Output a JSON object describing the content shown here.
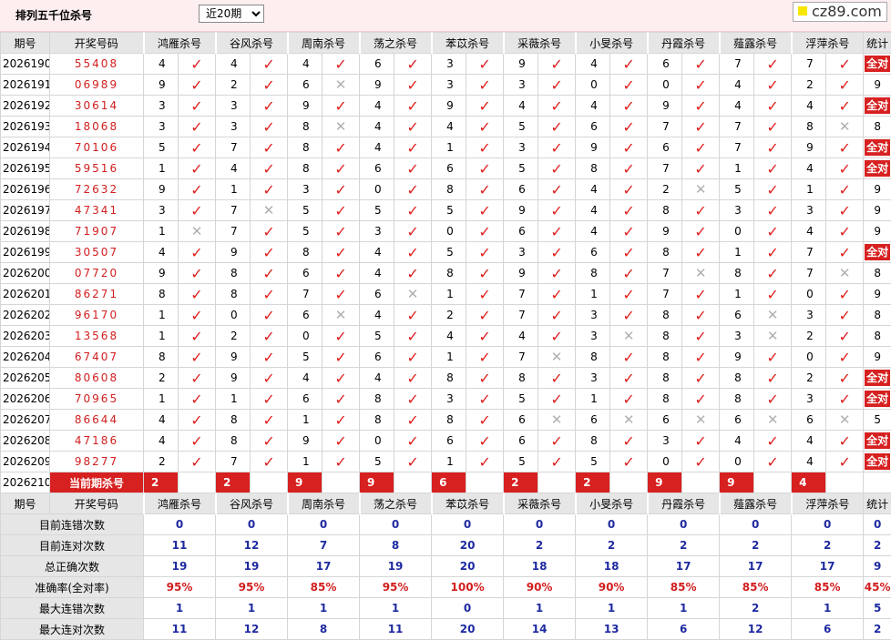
{
  "page": {
    "title": "排列五千位杀号",
    "period_select": {
      "value": "近20期",
      "options": [
        "近20期"
      ]
    },
    "logo": "cz89.com"
  },
  "headers": {
    "period": "期号",
    "draw": "开奖号码",
    "experts": [
      "鸿雁杀号",
      "谷风杀号",
      "周南杀号",
      "荡之杀号",
      "苯苡杀号",
      "采薇杀号",
      "小旻杀号",
      "丹霞杀号",
      "薤露杀号",
      "浮萍杀号"
    ],
    "total": "统计"
  },
  "rows": [
    {
      "period": "2026190",
      "draw": "55408",
      "kills": [
        4,
        4,
        4,
        6,
        3,
        9,
        4,
        6,
        7,
        7
      ],
      "ok": [
        1,
        1,
        1,
        1,
        1,
        1,
        1,
        1,
        1,
        1
      ],
      "count": "全对",
      "all": true
    },
    {
      "period": "2026191",
      "draw": "06989",
      "kills": [
        9,
        2,
        6,
        9,
        3,
        3,
        0,
        0,
        4,
        2
      ],
      "ok": [
        1,
        1,
        0,
        1,
        1,
        1,
        1,
        1,
        1,
        1
      ],
      "count": "9",
      "all": false
    },
    {
      "period": "2026192",
      "draw": "30614",
      "kills": [
        3,
        3,
        9,
        4,
        9,
        4,
        4,
        9,
        4,
        4
      ],
      "ok": [
        1,
        1,
        1,
        1,
        1,
        1,
        1,
        1,
        1,
        1
      ],
      "count": "全对",
      "all": true
    },
    {
      "period": "2026193",
      "draw": "18068",
      "kills": [
        3,
        3,
        8,
        4,
        4,
        5,
        6,
        7,
        7,
        8
      ],
      "ok": [
        1,
        1,
        0,
        1,
        1,
        1,
        1,
        1,
        1,
        0
      ],
      "count": "8",
      "all": false
    },
    {
      "period": "2026194",
      "draw": "70106",
      "kills": [
        5,
        7,
        8,
        4,
        1,
        3,
        9,
        6,
        7,
        9
      ],
      "ok": [
        1,
        1,
        1,
        1,
        1,
        1,
        1,
        1,
        1,
        1
      ],
      "count": "全对",
      "all": true
    },
    {
      "period": "2026195",
      "draw": "59516",
      "kills": [
        1,
        4,
        8,
        6,
        6,
        5,
        8,
        7,
        1,
        4
      ],
      "ok": [
        1,
        1,
        1,
        1,
        1,
        1,
        1,
        1,
        1,
        1
      ],
      "count": "全对",
      "all": true
    },
    {
      "period": "2026196",
      "draw": "72632",
      "kills": [
        9,
        1,
        3,
        0,
        8,
        6,
        4,
        2,
        5,
        1
      ],
      "ok": [
        1,
        1,
        1,
        1,
        1,
        1,
        1,
        0,
        1,
        1
      ],
      "count": "9",
      "all": false
    },
    {
      "period": "2026197",
      "draw": "47341",
      "kills": [
        3,
        7,
        5,
        5,
        5,
        9,
        4,
        8,
        3,
        3
      ],
      "ok": [
        1,
        0,
        1,
        1,
        1,
        1,
        1,
        1,
        1,
        1
      ],
      "count": "9",
      "all": false
    },
    {
      "period": "2026198",
      "draw": "71907",
      "kills": [
        1,
        7,
        5,
        3,
        0,
        6,
        4,
        9,
        0,
        4
      ],
      "ok": [
        0,
        1,
        1,
        1,
        1,
        1,
        1,
        1,
        1,
        1
      ],
      "count": "9",
      "all": false
    },
    {
      "period": "2026199",
      "draw": "30507",
      "kills": [
        4,
        9,
        8,
        4,
        5,
        3,
        6,
        8,
        1,
        7
      ],
      "ok": [
        1,
        1,
        1,
        1,
        1,
        1,
        1,
        1,
        1,
        1
      ],
      "count": "全对",
      "all": true
    },
    {
      "period": "2026200",
      "draw": "07720",
      "kills": [
        9,
        8,
        6,
        4,
        8,
        9,
        8,
        7,
        8,
        7
      ],
      "ok": [
        1,
        1,
        1,
        1,
        1,
        1,
        1,
        0,
        1,
        0
      ],
      "count": "8",
      "all": false
    },
    {
      "period": "2026201",
      "draw": "86271",
      "kills": [
        8,
        8,
        7,
        6,
        1,
        7,
        1,
        7,
        1,
        0
      ],
      "ok": [
        1,
        1,
        1,
        0,
        1,
        1,
        1,
        1,
        1,
        1
      ],
      "count": "9",
      "all": false
    },
    {
      "period": "2026202",
      "draw": "96170",
      "kills": [
        1,
        0,
        6,
        4,
        2,
        7,
        3,
        8,
        6,
        3
      ],
      "ok": [
        1,
        1,
        0,
        1,
        1,
        1,
        1,
        1,
        0,
        1
      ],
      "count": "8",
      "all": false
    },
    {
      "period": "2026203",
      "draw": "13568",
      "kills": [
        1,
        2,
        0,
        5,
        4,
        4,
        3,
        8,
        3,
        2
      ],
      "ok": [
        1,
        1,
        1,
        1,
        1,
        1,
        0,
        1,
        0,
        1
      ],
      "count": "8",
      "all": false
    },
    {
      "period": "2026204",
      "draw": "67407",
      "kills": [
        8,
        9,
        5,
        6,
        1,
        7,
        8,
        8,
        9,
        0
      ],
      "ok": [
        1,
        1,
        1,
        1,
        1,
        0,
        1,
        1,
        1,
        1
      ],
      "count": "9",
      "all": false
    },
    {
      "period": "2026205",
      "draw": "80608",
      "kills": [
        2,
        9,
        4,
        4,
        8,
        8,
        3,
        8,
        8,
        2
      ],
      "ok": [
        1,
        1,
        1,
        1,
        1,
        1,
        1,
        1,
        1,
        1
      ],
      "count": "全对",
      "all": true
    },
    {
      "period": "2026206",
      "draw": "70965",
      "kills": [
        1,
        1,
        6,
        8,
        3,
        5,
        1,
        8,
        8,
        3
      ],
      "ok": [
        1,
        1,
        1,
        1,
        1,
        1,
        1,
        1,
        1,
        1
      ],
      "count": "全对",
      "all": true
    },
    {
      "period": "2026207",
      "draw": "86644",
      "kills": [
        4,
        8,
        1,
        8,
        8,
        6,
        6,
        6,
        6,
        6
      ],
      "ok": [
        1,
        1,
        1,
        1,
        1,
        0,
        0,
        0,
        0,
        0
      ],
      "count": "5",
      "all": false
    },
    {
      "period": "2026208",
      "draw": "47186",
      "kills": [
        4,
        8,
        9,
        0,
        6,
        6,
        8,
        3,
        4,
        4
      ],
      "ok": [
        1,
        1,
        1,
        1,
        1,
        1,
        1,
        1,
        1,
        1
      ],
      "count": "全对",
      "all": true
    },
    {
      "period": "2026209",
      "draw": "98277",
      "kills": [
        2,
        7,
        1,
        5,
        1,
        5,
        5,
        0,
        0,
        4
      ],
      "ok": [
        1,
        1,
        1,
        1,
        1,
        1,
        1,
        1,
        1,
        1
      ],
      "count": "全对",
      "all": true
    }
  ],
  "current": {
    "period": "2026210",
    "label": "当前期杀号",
    "kills": [
      "2",
      "2",
      "9",
      "9",
      "6",
      "2",
      "2",
      "9",
      "9",
      "4"
    ]
  },
  "stats": [
    {
      "label": "目前连错次数",
      "values": [
        "0",
        "0",
        "0",
        "0",
        "0",
        "0",
        "0",
        "0",
        "0",
        "0"
      ],
      "total": "0",
      "type": "v"
    },
    {
      "label": "目前连对次数",
      "values": [
        "11",
        "12",
        "7",
        "8",
        "20",
        "2",
        "2",
        "2",
        "2",
        "2"
      ],
      "total": "2",
      "type": "v"
    },
    {
      "label": "总正确次数",
      "values": [
        "19",
        "19",
        "17",
        "19",
        "20",
        "18",
        "18",
        "17",
        "17",
        "17"
      ],
      "total": "9",
      "type": "v"
    },
    {
      "label": "准确率(全对率)",
      "values": [
        "95%",
        "95%",
        "85%",
        "95%",
        "100%",
        "90%",
        "90%",
        "85%",
        "85%",
        "85%"
      ],
      "total": "45%",
      "type": "pct"
    },
    {
      "label": "最大连错次数",
      "values": [
        "1",
        "1",
        "1",
        "1",
        "0",
        "1",
        "1",
        "1",
        "2",
        "1"
      ],
      "total": "5",
      "type": "v"
    },
    {
      "label": "最大连对次数",
      "values": [
        "11",
        "12",
        "8",
        "11",
        "20",
        "14",
        "13",
        "6",
        "12",
        "6"
      ],
      "total": "2",
      "type": "v"
    }
  ],
  "marks": {
    "check": "✓",
    "cross": "✕"
  },
  "colors": {
    "accent": "#d72020",
    "stat_blue": "#1e2aa0",
    "header_bg": "#e6e6e6",
    "topbar_bg": "#fdeef0"
  }
}
